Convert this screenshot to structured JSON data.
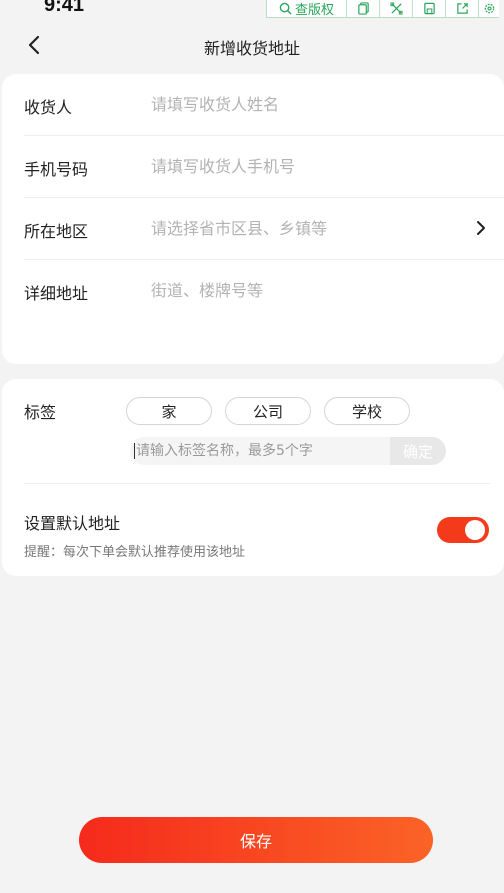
{
  "status_bar": {
    "time": "9:41"
  },
  "toolbar": {
    "check_label": "查版权"
  },
  "nav": {
    "title": "新增收货地址"
  },
  "form": {
    "rows": [
      {
        "label": "收货人",
        "placeholder": "请填写收货人姓名"
      },
      {
        "label": "手机号码",
        "placeholder": "请填写收货人手机号"
      },
      {
        "label": "所在地区",
        "placeholder": "请选择省市区县、乡镇等"
      },
      {
        "label": "详细地址",
        "placeholder": "街道、楼牌号等"
      }
    ]
  },
  "tags": {
    "label": "标签",
    "options": [
      "家",
      "公司",
      "学校"
    ],
    "input_placeholder": "请输入标签名称，最多5个字",
    "confirm_label": "确定"
  },
  "default_address": {
    "title": "设置默认地址",
    "hint": "提醒：每次下单会默认推荐使用该地址",
    "enabled": true
  },
  "save_label": "保存",
  "colors": {
    "accent": "#f33a1a",
    "button_gradient_start": "#f52a1c",
    "button_gradient_end": "#fb6326",
    "toolbar_green": "#2aa65a"
  }
}
